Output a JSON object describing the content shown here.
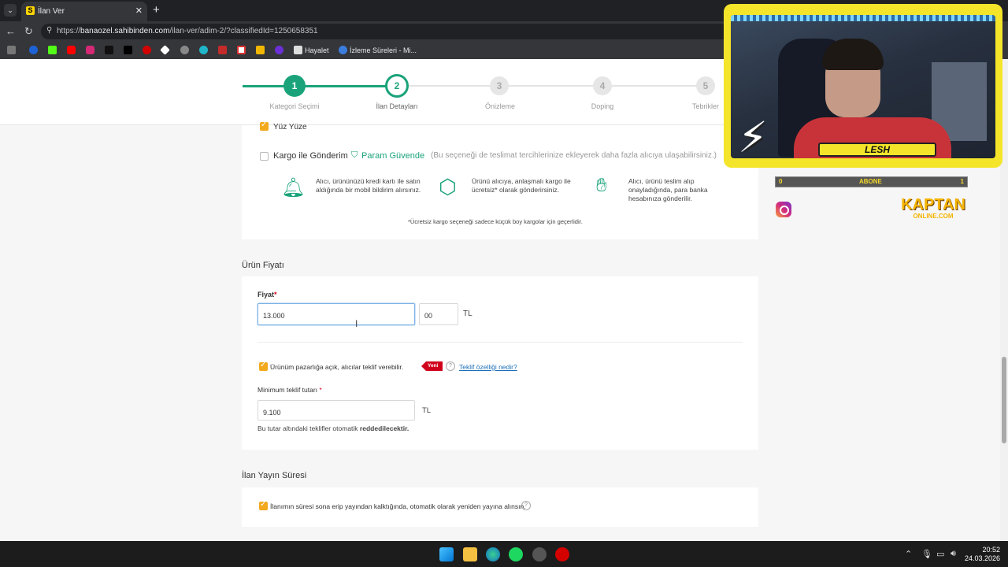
{
  "browser": {
    "tab_title": "İlan Ver",
    "tab_favicon": "S",
    "tab_close": "✕",
    "new_tab": "+",
    "url_prefix": "https://",
    "url_host": "banaozel.sahibinden.com",
    "url_path": "/ilan-ver/adim-2/?classifiedId=1250658351",
    "bookmarks": {
      "hayalet": "Hayalet",
      "izleme": "İzleme Süreleri - Mi..."
    }
  },
  "steps": [
    {
      "number": "1",
      "label": "Kategori Seçimi",
      "state": "done"
    },
    {
      "number": "2",
      "label": "İlan Detayları",
      "state": "active"
    },
    {
      "number": "3",
      "label": "Önizleme",
      "state": "pending"
    },
    {
      "number": "4",
      "label": "Doping",
      "state": "pending"
    },
    {
      "number": "5",
      "label": "Tebrikler",
      "state": "pending"
    }
  ],
  "shipping": {
    "partial_option_label": "Yüz Yüze",
    "cargo_label": "Kargo ile Gönderim",
    "safe_pay_label": "Param Güvende",
    "cargo_hint": "(Bu seçeneği de teslimat tercihlerinize ekleyerek daha fazla alıcıya ulaşabilirsiniz.)",
    "info_1": "Alıcı, ürününüzü kredi kartı ile satın aldığında bir mobil bildirim alırsınız.",
    "info_2": "Ürünü alıcıya, anlaşmalı kargo ile ücretsiz* olarak gönderirsiniz.",
    "info_3": "Alıcı, ürünü teslim alıp onayladığında, para banka hesabınıza gönderilir.",
    "footnote": "*Ücretsiz kargo seçeneği sadece küçük boy kargolar için geçerlidir."
  },
  "price": {
    "section_title": "Ürün Fiyatı",
    "label": "Fiyat",
    "required_mark": "*",
    "value": "13.000",
    "cents": "00",
    "currency": "TL",
    "negotiable_label": "Ürünüm pazarlığa açık, alıcılar teklif verebilir.",
    "new_badge": "Yeni",
    "help_mark": "?",
    "offer_link": "Teklif özelliği nedir?",
    "min_offer_label": "Minimum teklif tutarı",
    "min_offer_value": "9.100",
    "min_offer_currency": "TL",
    "reject_note_prefix": "Bu tutar altındaki teklifler otomatik ",
    "reject_note_bold": "reddedilecektir."
  },
  "publish": {
    "section_title": "İlan Yayın Süresi",
    "auto_renew_label": "İlanımın süresi sona erip yayından kalktığında, otomatik olarak yeniden yayına alınsın.",
    "help_mark": "?"
  },
  "overlay": {
    "streamer_name": "LESH",
    "sub_label": "ABONE",
    "sub_current": "0",
    "sub_goal": "1",
    "brand_line1": "KAPTAN",
    "brand_line2": "ONLINE.COM"
  },
  "taskbar": {
    "time": "20:52",
    "date": "24.03.2026"
  },
  "colors": {
    "green": "#1aa37a",
    "orange": "#f3a91c",
    "accent_blue": "#1b6fb7",
    "badge_red": "#d0021b"
  }
}
